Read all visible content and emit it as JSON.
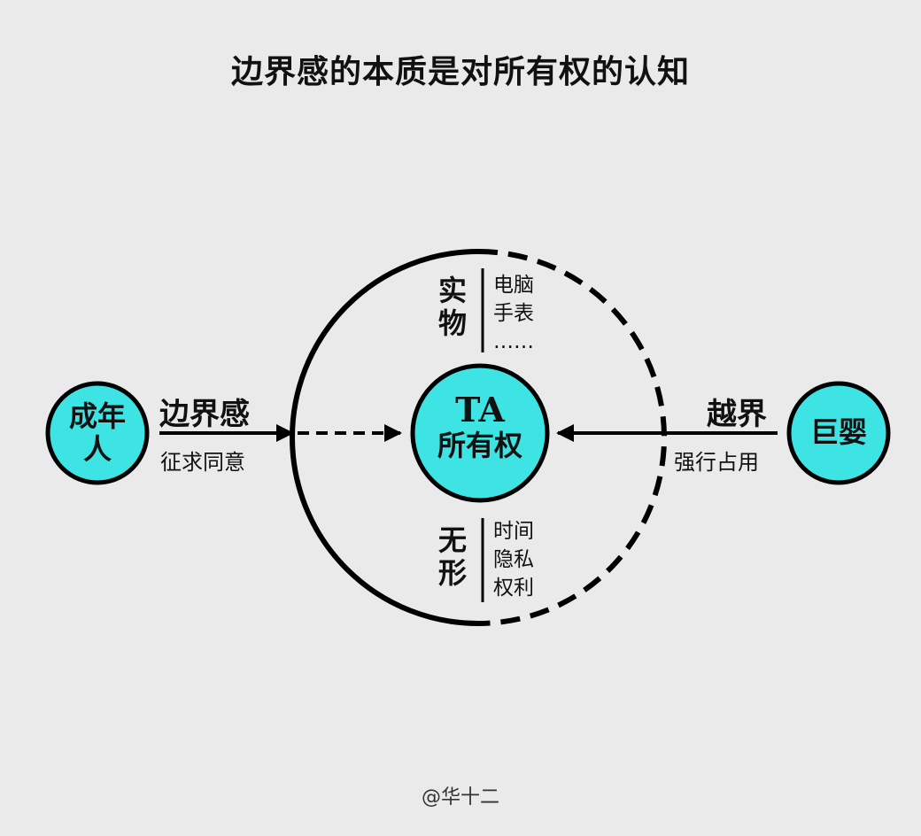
{
  "title": "边界感的本质是对所有权的认知",
  "colors": {
    "node_fill": "#3ee3e3",
    "stroke": "#000000",
    "background": "#eaeaea"
  },
  "left_node": {
    "line1": "成年",
    "line2": "人"
  },
  "right_node": {
    "text": "巨婴"
  },
  "center_node": {
    "line1": "TA",
    "line2": "所有权"
  },
  "left_arrow": {
    "label": "边界感",
    "sub": "征求同意"
  },
  "right_arrow": {
    "label": "越界",
    "sub": "强行占用"
  },
  "tangible": {
    "label_line1": "实",
    "label_line2": "物",
    "items": [
      "电脑",
      "手表",
      "……"
    ]
  },
  "intangible": {
    "label_line1": "无",
    "label_line2": "形",
    "items": [
      "时间",
      "隐私",
      "权利"
    ]
  },
  "watermark": "@华十二"
}
